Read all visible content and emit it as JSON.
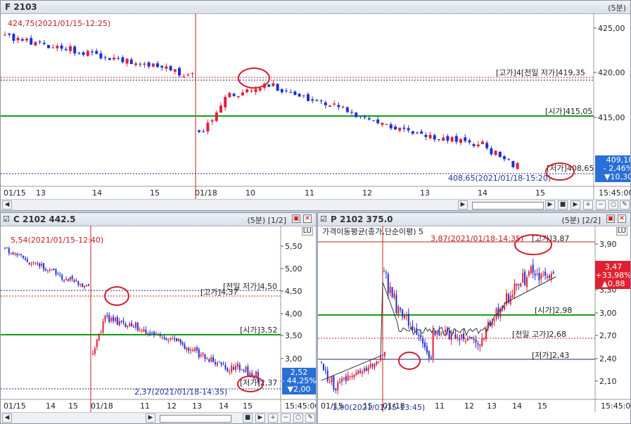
{
  "top": {
    "title": "F 2103",
    "interval": "(5분)",
    "y_labels": [
      "425,00",
      "420,00",
      "415,00"
    ],
    "x_labels": [
      "01/15",
      "13",
      "14",
      "15",
      "01/18",
      "10",
      "11",
      "12",
      "13",
      "14",
      "15",
      "15:45:00"
    ],
    "annotations": {
      "high": "424,75(2021/01/15-12:25)",
      "prevlow": "[고가]4[전일 저가]419,35",
      "open": "[시가]415,05",
      "low": "[저가]408,65",
      "lowtime": "408,65(2021/01/18-15:20)"
    },
    "badge": {
      "price": "409,10",
      "pct": "- 2,46%",
      "chg": "▼10,30"
    },
    "color_up": "#e0203a",
    "color_down": "#1f2fd8"
  },
  "left": {
    "title": "C 2102 442.5",
    "interval": "(5분)",
    "page": "[1/2]",
    "y_labels": [
      "5,50",
      "5,00",
      "4,50",
      "4,00",
      "3,50",
      "3,00",
      "2,50"
    ],
    "x_labels": [
      "01/15",
      "14",
      "15",
      "01/18",
      "11",
      "12",
      "13",
      "14",
      "15",
      "15:45:00"
    ],
    "annotations": {
      "high": "5,54(2021/01/15-12:40)",
      "prevlow": "[전일 저가]4,50",
      "highlabel": "[고가]4,37",
      "open": "[시가]3,52",
      "low": "[저가]2,37",
      "lowtime": "2,37(2021/01/18-14:35)"
    },
    "badge": {
      "price": "2,52",
      "pct": "- 44,25%",
      "chg": "▼2,00"
    }
  },
  "right": {
    "title": "P 2102 375.0",
    "interval": "(5분)",
    "page": "[2/2]",
    "indicator": "가격이동평균(종가,단순이평) 5",
    "y_labels": [
      "3,90",
      "3,60",
      "3,30",
      "3,00",
      "2,70",
      "2,40",
      "2,10"
    ],
    "x_labels": [
      "01/15",
      "15",
      "01/18",
      "11",
      "12",
      "13",
      "14",
      "15",
      "15:45:00"
    ],
    "annotations": {
      "high": "3,87(2021/01/18-14:35)",
      "highlabel": "[고가]3,87",
      "open": "[시가]2,98",
      "prevhigh": "[전일 고가]2,68",
      "low": "[저가]2,43",
      "lowtime": "1,90(2021/01/15-13:45)"
    },
    "badge": {
      "price": "3,47",
      "pct": "+33,98%",
      "chg": "▲0,88"
    }
  },
  "toolbar_icons": [
    "scroll-left-icon",
    "play-icon",
    "stop-icon",
    "scroll-right-icon",
    "zoom-in-icon",
    "zoom-out-icon",
    "zoom-reset-icon",
    "wrench-icon"
  ]
}
